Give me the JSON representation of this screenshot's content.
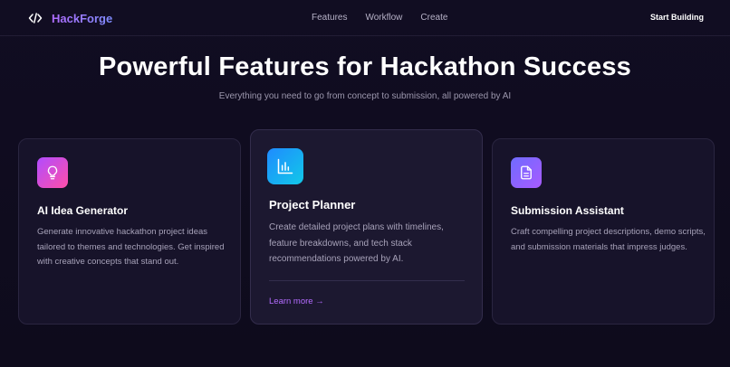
{
  "nav": {
    "brand": "HackForge",
    "links": [
      "Features",
      "Workflow",
      "Create"
    ],
    "cta": "Start Building"
  },
  "hero": {
    "title": "Powerful Features for Hackathon Success",
    "subtitle": "Everything you need to go from concept to submission, all powered by AI"
  },
  "cards": [
    {
      "icon": "lightbulb-icon",
      "title": "AI Idea Generator",
      "description": "Generate innovative hackathon project ideas tailored to themes and technologies. Get inspired with creative concepts that stand out."
    },
    {
      "icon": "chart-icon",
      "title": "Project Planner",
      "description": "Create detailed project plans with timelines, feature breakdowns, and tech stack recommendations powered by AI.",
      "link": "Learn more →"
    },
    {
      "icon": "document-icon",
      "title": "Submission Assistant",
      "description": "Craft compelling project descriptions, demo scripts, and submission materials that impress judges."
    }
  ],
  "colors": {
    "background": "#0f0c1f",
    "card": "#17132a",
    "accent": "#b46cff",
    "text_muted": "#a7a2b9"
  }
}
